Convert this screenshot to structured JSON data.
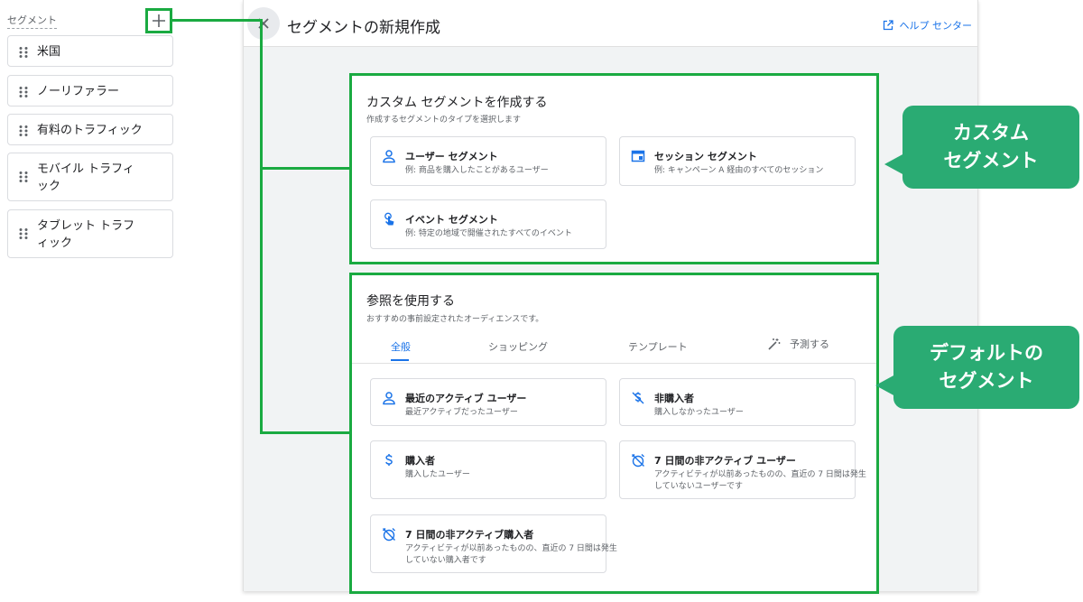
{
  "sidebar": {
    "header": "セグメント",
    "items": [
      {
        "label": "米国"
      },
      {
        "label": "ノーリファラー"
      },
      {
        "label": "有料のトラフィック"
      },
      {
        "label": "モバイル トラフィ\nック"
      },
      {
        "label": "タブレット トラフ\nィック"
      }
    ]
  },
  "panel": {
    "title": "セグメントの新規作成",
    "help_label": "ヘルプ センター"
  },
  "custom": {
    "title": "カスタム セグメントを作成する",
    "subtitle": "作成するセグメントのタイプを選択します",
    "options": [
      {
        "title": "ユーザー セグメント",
        "subtitle": "例: 商品を購入したことがあるユーザー",
        "icon": "person-icon"
      },
      {
        "title": "セッション セグメント",
        "subtitle": "例: キャンペーン A 経由のすべてのセッション",
        "icon": "session-icon"
      },
      {
        "title": "イベント セグメント",
        "subtitle": "例: 特定の地域で開催されたすべてのイベント",
        "icon": "touch-icon"
      }
    ]
  },
  "reference": {
    "title": "参照を使用する",
    "subtitle": "おすすめの事前設定されたオーディエンスです。",
    "tabs": [
      {
        "label": "全般",
        "active": true
      },
      {
        "label": "ショッピング",
        "active": false
      },
      {
        "label": "テンプレート",
        "active": false
      },
      {
        "label": "予測する",
        "active": false
      }
    ],
    "options": [
      {
        "title": "最近のアクティブ ユーザー",
        "subtitle": "最近アクティブだったユーザー",
        "icon": "person-icon"
      },
      {
        "title": "非購入者",
        "subtitle": "購入しなかったユーザー",
        "icon": "no-money-icon"
      },
      {
        "title": "購入者",
        "subtitle": "購入したユーザー",
        "icon": "dollar-icon"
      },
      {
        "title": "7 日間の非アクティブ ユーザー",
        "subtitle": "アクティビティが以前あったものの、直近の 7 日間は発生していないユーザーです",
        "icon": "alarm-off-icon"
      },
      {
        "title": "7 日間の非アクティブ購入者",
        "subtitle": "アクティビティが以前あったものの、直近の 7 日間は発生していない購入者です",
        "icon": "alarm-off-icon"
      }
    ]
  },
  "callouts": {
    "custom": "カスタム\nセグメント",
    "default": "デフォルトの\nセグメント"
  },
  "colors": {
    "accent": "#1a73e8",
    "annotation": "#1aaa41",
    "callout": "#2aab73"
  }
}
